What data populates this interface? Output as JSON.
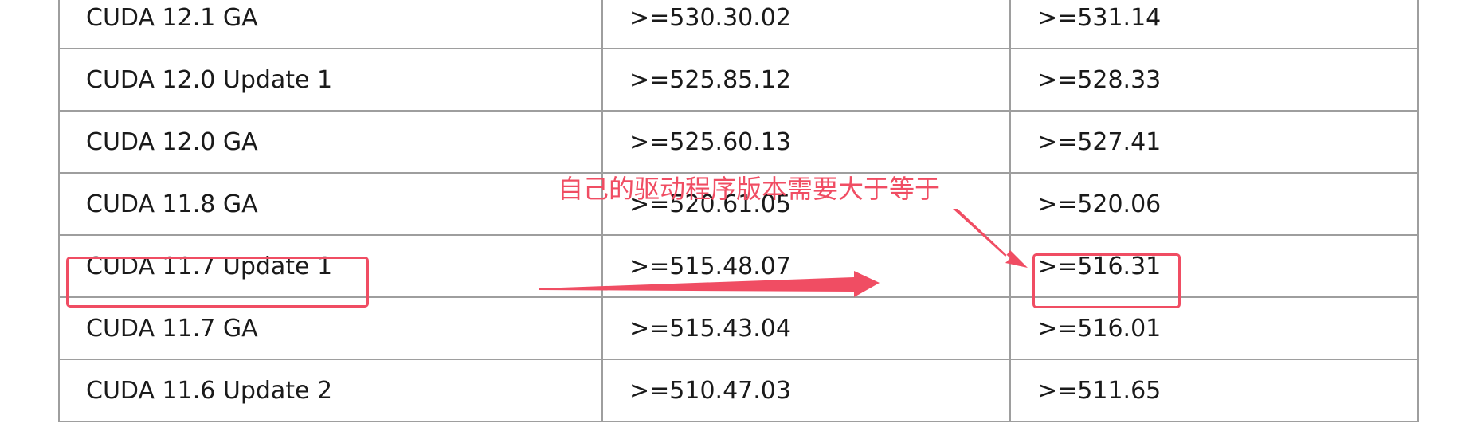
{
  "table": {
    "rows": [
      {
        "version": "CUDA 12.1 GA",
        "linux_driver": ">=530.30.02",
        "windows_driver": ">=531.14"
      },
      {
        "version": "CUDA 12.0 Update 1",
        "linux_driver": ">=525.85.12",
        "windows_driver": ">=528.33"
      },
      {
        "version": "CUDA 12.0 GA",
        "linux_driver": ">=525.60.13",
        "windows_driver": ">=527.41"
      },
      {
        "version": "CUDA 11.8 GA",
        "linux_driver": ">=520.61.05",
        "windows_driver": ">=520.06"
      },
      {
        "version": "CUDA 11.7 Update 1",
        "linux_driver": ">=515.48.07",
        "windows_driver": ">=516.31"
      },
      {
        "version": "CUDA 11.7 GA",
        "linux_driver": ">=515.43.04",
        "windows_driver": ">=516.01"
      },
      {
        "version": "CUDA 11.6 Update 2",
        "linux_driver": ">=510.47.03",
        "windows_driver": ">=511.65"
      }
    ]
  },
  "annotation": {
    "text": "自己的驱动程序版本需要大于等于",
    "color": "#f04d63"
  }
}
